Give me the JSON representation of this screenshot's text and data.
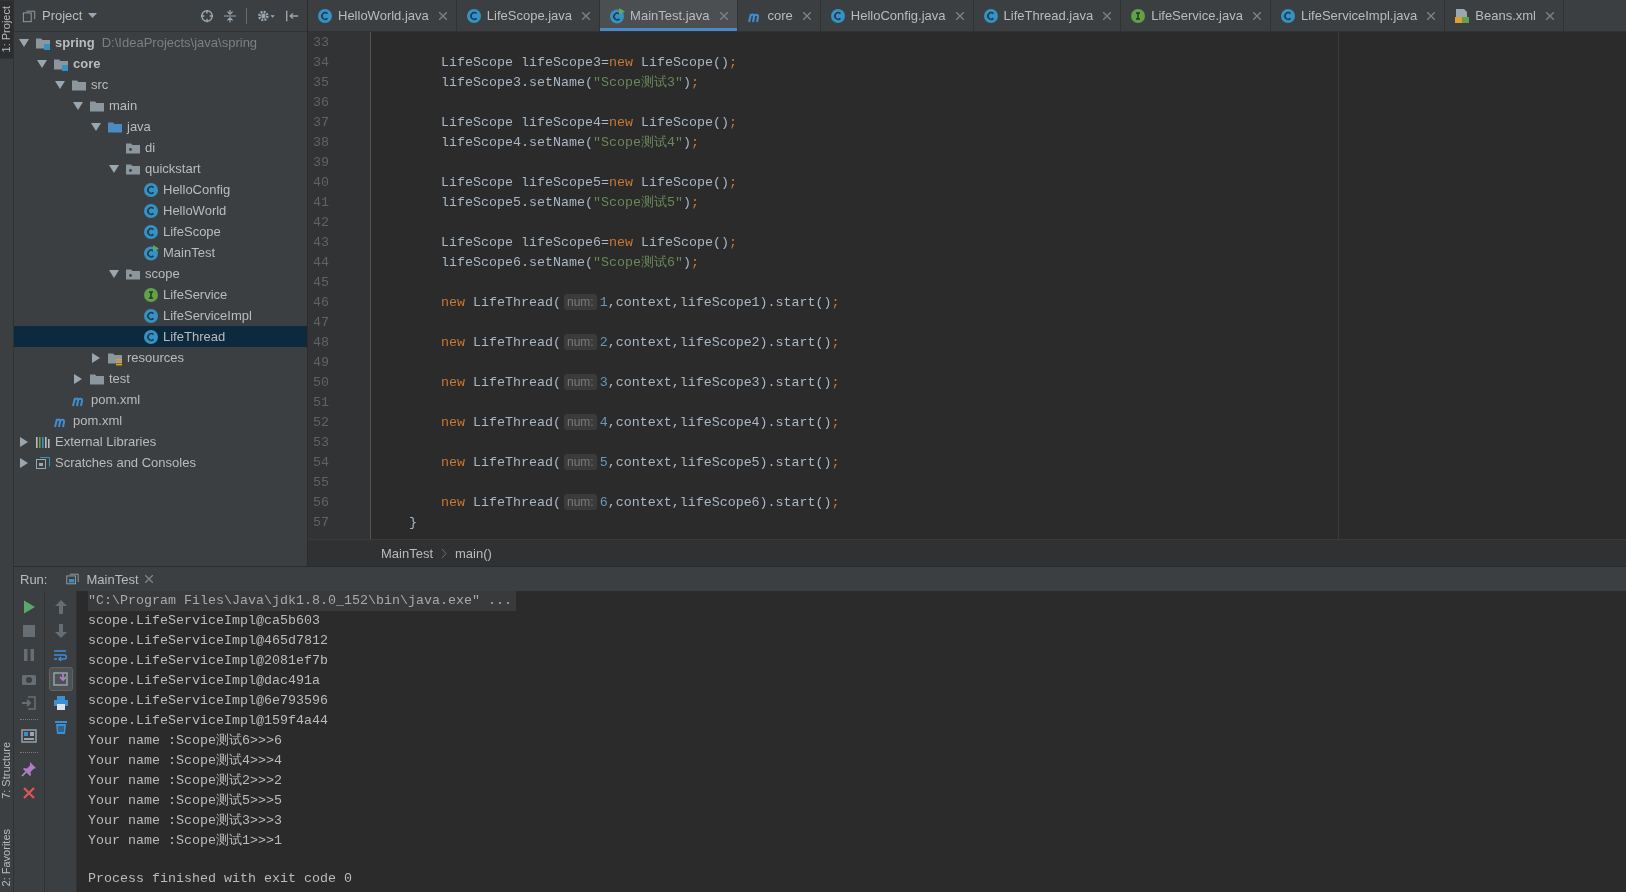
{
  "tool_strip": [
    {
      "label": "1: Project",
      "selected": true
    },
    {
      "label": "7: Structure",
      "selected": false
    },
    {
      "label": "2: Favorites",
      "selected": false
    }
  ],
  "project": {
    "title": "Project",
    "tree": [
      {
        "label": "spring",
        "path": "D:\\IdeaProjects\\java\\spring",
        "kind": "module",
        "expanded": true,
        "selected": false,
        "children": [
          {
            "label": "core",
            "kind": "module",
            "expanded": true,
            "selected": false,
            "children": [
              {
                "label": "src",
                "kind": "folder",
                "expanded": true,
                "selected": false,
                "children": [
                  {
                    "label": "main",
                    "kind": "folder",
                    "expanded": true,
                    "selected": false,
                    "children": [
                      {
                        "label": "java",
                        "kind": "source-folder",
                        "expanded": true,
                        "selected": false,
                        "children": [
                          {
                            "label": "di",
                            "kind": "package",
                            "selected": false
                          },
                          {
                            "label": "quickstart",
                            "kind": "package",
                            "expanded": true,
                            "selected": false,
                            "children": [
                              {
                                "label": "HelloConfig",
                                "kind": "class",
                                "selected": false
                              },
                              {
                                "label": "HelloWorld",
                                "kind": "class",
                                "selected": false
                              },
                              {
                                "label": "LifeScope",
                                "kind": "class",
                                "selected": false
                              },
                              {
                                "label": "MainTest",
                                "kind": "main-class",
                                "selected": false
                              }
                            ]
                          },
                          {
                            "label": "scope",
                            "kind": "package",
                            "expanded": true,
                            "selected": false,
                            "children": [
                              {
                                "label": "LifeService",
                                "kind": "interface",
                                "selected": false
                              },
                              {
                                "label": "LifeServiceImpl",
                                "kind": "class",
                                "selected": false
                              },
                              {
                                "label": "LifeThread",
                                "kind": "class",
                                "selected": true
                              }
                            ]
                          }
                        ]
                      },
                      {
                        "label": "resources",
                        "kind": "resources",
                        "expanded": false,
                        "selected": false
                      }
                    ]
                  },
                  {
                    "label": "test",
                    "kind": "folder",
                    "expanded": false,
                    "selected": false
                  }
                ]
              },
              {
                "label": "pom.xml",
                "kind": "maven",
                "selected": false
              }
            ]
          },
          {
            "label": "pom.xml",
            "kind": "maven",
            "selected": false
          }
        ]
      },
      {
        "label": "External Libraries",
        "kind": "libraries",
        "expanded": false,
        "selected": false
      },
      {
        "label": "Scratches and Consoles",
        "kind": "scratches",
        "expanded": false,
        "selected": false
      }
    ]
  },
  "tabs": [
    {
      "label": "HelloWorld.java",
      "kind": "class",
      "selected": false
    },
    {
      "label": "LifeScope.java",
      "kind": "class",
      "selected": false
    },
    {
      "label": "MainTest.java",
      "kind": "main-class",
      "selected": true
    },
    {
      "label": "core",
      "kind": "maven",
      "selected": false
    },
    {
      "label": "HelloConfig.java",
      "kind": "class",
      "selected": false
    },
    {
      "label": "LifeThread.java",
      "kind": "class",
      "selected": false
    },
    {
      "label": "LifeService.java",
      "kind": "interface",
      "selected": false
    },
    {
      "label": "LifeServiceImpl.java",
      "kind": "class",
      "selected": false
    },
    {
      "label": "Beans.xml",
      "kind": "xml",
      "selected": false
    }
  ],
  "code": {
    "lines": [
      {
        "number": "33"
      },
      {
        "number": "34",
        "tokens": [
          {
            "text": "        LifeScope lifeScope3=",
            "kind": "plain"
          },
          {
            "text": "new",
            "kind": "keyword"
          },
          {
            "text": " LifeScope()",
            "kind": "plain"
          },
          {
            "text": ";",
            "kind": "keyword"
          }
        ]
      },
      {
        "number": "35",
        "tokens": [
          {
            "text": "        lifeScope3.setName(",
            "kind": "plain"
          },
          {
            "text": "\"Scope测试3\"",
            "kind": "string"
          },
          {
            "text": ")",
            "kind": "plain"
          },
          {
            "text": ";",
            "kind": "keyword"
          }
        ]
      },
      {
        "number": "36"
      },
      {
        "number": "37",
        "tokens": [
          {
            "text": "        LifeScope lifeScope4=",
            "kind": "plain"
          },
          {
            "text": "new",
            "kind": "keyword"
          },
          {
            "text": " LifeScope()",
            "kind": "plain"
          },
          {
            "text": ";",
            "kind": "keyword"
          }
        ]
      },
      {
        "number": "38",
        "tokens": [
          {
            "text": "        lifeScope4.setName(",
            "kind": "plain"
          },
          {
            "text": "\"Scope测试4\"",
            "kind": "string"
          },
          {
            "text": ")",
            "kind": "plain"
          },
          {
            "text": ";",
            "kind": "keyword"
          }
        ]
      },
      {
        "number": "39"
      },
      {
        "number": "40",
        "tokens": [
          {
            "text": "        LifeScope lifeScope5=",
            "kind": "plain"
          },
          {
            "text": "new",
            "kind": "keyword"
          },
          {
            "text": " LifeScope()",
            "kind": "plain"
          },
          {
            "text": ";",
            "kind": "keyword"
          }
        ]
      },
      {
        "number": "41",
        "tokens": [
          {
            "text": "        lifeScope5.setName(",
            "kind": "plain"
          },
          {
            "text": "\"Scope测试5\"",
            "kind": "string"
          },
          {
            "text": ")",
            "kind": "plain"
          },
          {
            "text": ";",
            "kind": "keyword"
          }
        ]
      },
      {
        "number": "42"
      },
      {
        "number": "43",
        "tokens": [
          {
            "text": "        LifeScope lifeScope6=",
            "kind": "plain"
          },
          {
            "text": "new",
            "kind": "keyword"
          },
          {
            "text": " LifeScope()",
            "kind": "plain"
          },
          {
            "text": ";",
            "kind": "keyword"
          }
        ]
      },
      {
        "number": "44",
        "tokens": [
          {
            "text": "        lifeScope6.setName(",
            "kind": "plain"
          },
          {
            "text": "\"Scope测试6\"",
            "kind": "string"
          },
          {
            "text": ")",
            "kind": "plain"
          },
          {
            "text": ";",
            "kind": "keyword"
          }
        ]
      },
      {
        "number": "45"
      },
      {
        "number": "46",
        "tokens": [
          {
            "text": "        new",
            "kind": "keyword"
          },
          {
            "text": " LifeThread(",
            "kind": "plain"
          },
          {
            "text": "num:",
            "kind": "hint"
          },
          {
            "text": "1",
            "kind": "number"
          },
          {
            "text": ",context,lifeScope1).start()",
            "kind": "plain"
          },
          {
            "text": ";",
            "kind": "keyword"
          }
        ]
      },
      {
        "number": "47"
      },
      {
        "number": "48",
        "tokens": [
          {
            "text": "        new",
            "kind": "keyword"
          },
          {
            "text": " LifeThread(",
            "kind": "plain"
          },
          {
            "text": "num:",
            "kind": "hint"
          },
          {
            "text": "2",
            "kind": "number"
          },
          {
            "text": ",context,lifeScope2).start()",
            "kind": "plain"
          },
          {
            "text": ";",
            "kind": "keyword"
          }
        ]
      },
      {
        "number": "49"
      },
      {
        "number": "50",
        "tokens": [
          {
            "text": "        new",
            "kind": "keyword"
          },
          {
            "text": " LifeThread(",
            "kind": "plain"
          },
          {
            "text": "num:",
            "kind": "hint"
          },
          {
            "text": "3",
            "kind": "number"
          },
          {
            "text": ",context,lifeScope3).start()",
            "kind": "plain"
          },
          {
            "text": ";",
            "kind": "keyword"
          }
        ]
      },
      {
        "number": "51"
      },
      {
        "number": "52",
        "tokens": [
          {
            "text": "        new",
            "kind": "keyword"
          },
          {
            "text": " LifeThread(",
            "kind": "plain"
          },
          {
            "text": "num:",
            "kind": "hint"
          },
          {
            "text": "4",
            "kind": "number"
          },
          {
            "text": ",context,lifeScope4).start()",
            "kind": "plain"
          },
          {
            "text": ";",
            "kind": "keyword"
          }
        ]
      },
      {
        "number": "53"
      },
      {
        "number": "54",
        "tokens": [
          {
            "text": "        new",
            "kind": "keyword"
          },
          {
            "text": " LifeThread(",
            "kind": "plain"
          },
          {
            "text": "num:",
            "kind": "hint"
          },
          {
            "text": "5",
            "kind": "number"
          },
          {
            "text": ",context,lifeScope5).start()",
            "kind": "plain"
          },
          {
            "text": ";",
            "kind": "keyword"
          }
        ]
      },
      {
        "number": "55"
      },
      {
        "number": "56",
        "tokens": [
          {
            "text": "        new",
            "kind": "keyword"
          },
          {
            "text": " LifeThread(",
            "kind": "plain"
          },
          {
            "text": "num:",
            "kind": "hint"
          },
          {
            "text": "6",
            "kind": "number"
          },
          {
            "text": ",context,lifeScope6).start()",
            "kind": "plain"
          },
          {
            "text": ";",
            "kind": "keyword"
          }
        ]
      },
      {
        "number": "57",
        "tokens": [
          {
            "text": "    }",
            "kind": "plain"
          }
        ]
      }
    ]
  },
  "breadcrumbs": [
    "MainTest",
    "main()"
  ],
  "run": {
    "label": "Run:",
    "tab": "MainTest",
    "toolbar_left": [
      {
        "kind": "run",
        "disabled": false
      },
      {
        "kind": "stop",
        "disabled": true
      },
      {
        "kind": "pause",
        "disabled": true
      },
      {
        "kind": "camera",
        "disabled": true
      },
      {
        "kind": "exit",
        "disabled": true
      },
      {
        "kind": "separator"
      },
      {
        "kind": "layout",
        "disabled": false
      },
      {
        "kind": "separator"
      },
      {
        "kind": "pin",
        "disabled": false
      },
      {
        "kind": "close",
        "disabled": false
      }
    ],
    "toolbar_right": [
      {
        "kind": "up",
        "disabled": true,
        "on": false
      },
      {
        "kind": "down",
        "disabled": true,
        "on": false
      },
      {
        "kind": "wrap",
        "disabled": false,
        "on": false
      },
      {
        "kind": "scroll-end",
        "disabled": false,
        "on": true
      },
      {
        "kind": "print",
        "disabled": false,
        "on": false
      },
      {
        "kind": "trash",
        "disabled": false,
        "on": false
      }
    ],
    "console": [
      {
        "text": "\"C:\\Program Files\\Java\\jdk1.8.0_152\\bin\\java.exe\" ...",
        "kind": "command"
      },
      {
        "text": "scope.LifeServiceImpl@ca5b603",
        "kind": "output"
      },
      {
        "text": "scope.LifeServiceImpl@465d7812",
        "kind": "output"
      },
      {
        "text": "scope.LifeServiceImpl@2081ef7b",
        "kind": "output"
      },
      {
        "text": "scope.LifeServiceImpl@dac491a",
        "kind": "output"
      },
      {
        "text": "scope.LifeServiceImpl@6e793596",
        "kind": "output"
      },
      {
        "text": "scope.LifeServiceImpl@159f4a44",
        "kind": "output"
      },
      {
        "text": "Your name :Scope测试6>>>6",
        "kind": "output"
      },
      {
        "text": "Your name :Scope测试4>>>4",
        "kind": "output"
      },
      {
        "text": "Your name :Scope测试2>>>2",
        "kind": "output"
      },
      {
        "text": "Your name :Scope测试5>>>5",
        "kind": "output"
      },
      {
        "text": "Your name :Scope测试3>>>3",
        "kind": "output"
      },
      {
        "text": "Your name :Scope测试1>>>1",
        "kind": "output"
      },
      {
        "text": "Process finished with exit code 0",
        "kind": "status"
      }
    ]
  }
}
